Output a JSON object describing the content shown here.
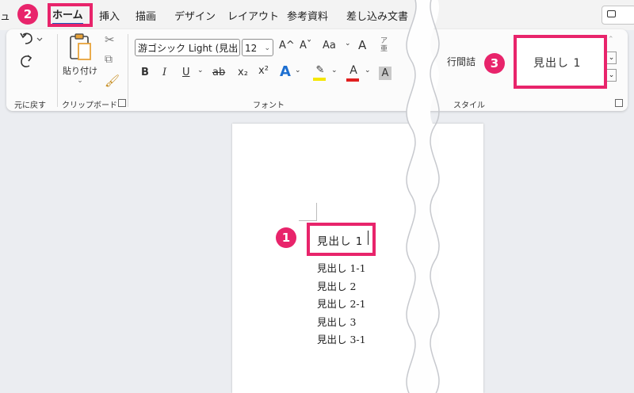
{
  "menubar": {
    "truncated_first": "ュ",
    "tabs": [
      "ホーム",
      "挿入",
      "描画",
      "デザイン",
      "レイアウト",
      "参考資料",
      "差し込み文書"
    ],
    "comment_label": "",
    "comment_icon": "comment-icon"
  },
  "ribbon": {
    "undo_group_label": "元に戻す",
    "clipboard": {
      "paste_label": "貼り付け",
      "group_label": "クリップボード"
    },
    "font": {
      "font_name": "游ゴシック Light (見出",
      "font_size": "12",
      "grow_label": "A^",
      "shrink_label": "Aˇ",
      "case_label": "Aa",
      "bold": "B",
      "italic": "I",
      "underline": "U",
      "strike": "ab",
      "subscript": "x₂",
      "superscript": "x²",
      "text_effect": "A",
      "highlight_color": "#f5e600",
      "font_color": "#e02020",
      "shade": "A",
      "group_label": "フォント"
    },
    "styles": {
      "partial_style": "行間詰",
      "heading1_preview": "見出し 1",
      "group_label": "スタイル"
    }
  },
  "document": {
    "headings": [
      "見出し 1",
      "見出し 1-1",
      "見出し 2",
      "見出し 2-1",
      "見出し 3",
      "見出し 3-1"
    ]
  },
  "annotations": {
    "badge1": "1",
    "badge2": "2",
    "badge3": "3",
    "accent_color": "#e8246b"
  }
}
